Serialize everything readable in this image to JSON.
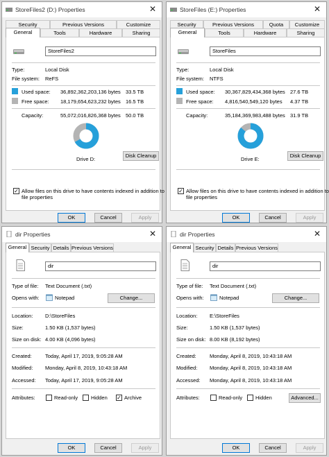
{
  "colors": {
    "used": "#26a0da",
    "free": "#b4b4b4",
    "accent": "#0078d7"
  },
  "tl": {
    "title": "StoreFiles2 (D:) Properties",
    "tabs_top": [
      "Security",
      "Previous Versions",
      "Customize"
    ],
    "tabs_bottom": [
      "General",
      "Tools",
      "Hardware",
      "Sharing"
    ],
    "name": "StoreFiles2",
    "type_label": "Type:",
    "type_value": "Local Disk",
    "fs_label": "File system:",
    "fs_value": "ReFS",
    "used_label": "Used space:",
    "used_bytes": "36,892,362,203,136 bytes",
    "used_size": "33.5 TB",
    "free_label": "Free space:",
    "free_bytes": "18,179,654,623,232 bytes",
    "free_size": "16.5 TB",
    "cap_label": "Capacity:",
    "cap_bytes": "55,072,016,826,368 bytes",
    "cap_size": "50.0 TB",
    "used_fraction": 0.67,
    "drive_label": "Drive D:",
    "cleanup": "Disk Cleanup",
    "index_text_1": "Allow files on this drive to have contents indexed in addition to",
    "index_text_2": "file properties",
    "ok": "OK",
    "cancel": "Cancel",
    "apply": "Apply"
  },
  "tr": {
    "title": "StoreFiles (E:) Properties",
    "tabs_top": [
      "Security",
      "Previous Versions",
      "Quota",
      "Customize"
    ],
    "tabs_bottom": [
      "General",
      "Tools",
      "Hardware",
      "Sharing"
    ],
    "name": "StoreFiles",
    "type_label": "Type:",
    "type_value": "Local Disk",
    "fs_label": "File system:",
    "fs_value": "NTFS",
    "used_label": "Used space:",
    "used_bytes": "30,367,829,434,368 bytes",
    "used_size": "27.6 TB",
    "free_label": "Free space:",
    "free_bytes": "4,816,540,549,120 bytes",
    "free_size": "4.37 TB",
    "cap_label": "Capacity:",
    "cap_bytes": "35,184,369,983,488 bytes",
    "cap_size": "31.9 TB",
    "used_fraction": 0.863,
    "drive_label": "Drive E:",
    "cleanup": "Disk Cleanup",
    "index_text_1": "Allow files on this drive to have contents indexed in addition to",
    "index_text_2": "file properties",
    "ok": "OK",
    "cancel": "Cancel",
    "apply": "Apply"
  },
  "bl": {
    "title": "dir Properties",
    "tabs": [
      "General",
      "Security",
      "Details",
      "Previous Versions"
    ],
    "name": "dir",
    "type_label": "Type of file:",
    "type_value": "Text Document (.txt)",
    "opens_label": "Opens with:",
    "opens_value": "Notepad",
    "change": "Change...",
    "loc_label": "Location:",
    "loc_value": "D:\\StoreFiles",
    "size_label": "Size:",
    "size_value": "1.50 KB (1,537 bytes)",
    "disk_label": "Size on disk:",
    "disk_value": "4.00 KB (4,096 bytes)",
    "created_label": "Created:",
    "created_value": "Today, April 17, 2019, 9:05:28 AM",
    "modified_label": "Modified:",
    "modified_value": "Monday, April 8, 2019, 10:43:18 AM",
    "accessed_label": "Accessed:",
    "accessed_value": "Today, April 17, 2019, 9:05:28 AM",
    "attr_label": "Attributes:",
    "readonly": "Read-only",
    "hidden": "Hidden",
    "archive": "Archive",
    "ok": "OK",
    "cancel": "Cancel",
    "apply": "Apply"
  },
  "br": {
    "title": "dir Properties",
    "tabs": [
      "General",
      "Security",
      "Details",
      "Previous Versions"
    ],
    "name": "dir",
    "type_label": "Type of file:",
    "type_value": "Text Document (.txt)",
    "opens_label": "Opens with:",
    "opens_value": "Notepad",
    "change": "Change...",
    "loc_label": "Location:",
    "loc_value": "E:\\StoreFiles",
    "size_label": "Size:",
    "size_value": "1.50 KB (1,537 bytes)",
    "disk_label": "Size on disk:",
    "disk_value": "8.00 KB (8,192 bytes)",
    "created_label": "Created:",
    "created_value": "Monday, April 8, 2019, 10:43:18 AM",
    "modified_label": "Modified:",
    "modified_value": "Monday, April 8, 2019, 10:43:18 AM",
    "accessed_label": "Accessed:",
    "accessed_value": "Monday, April 8, 2019, 10:43:18 AM",
    "attr_label": "Attributes:",
    "readonly": "Read-only",
    "hidden": "Hidden",
    "advanced": "Advanced...",
    "ok": "OK",
    "cancel": "Cancel",
    "apply": "Apply"
  }
}
